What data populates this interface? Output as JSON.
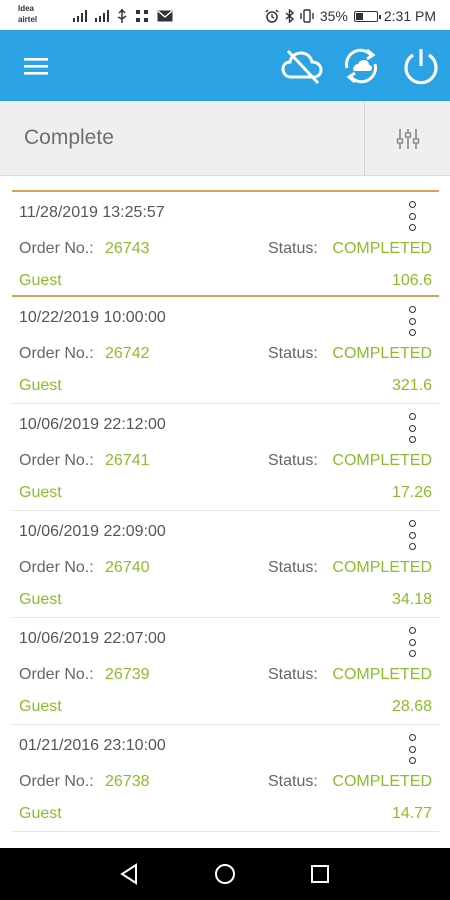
{
  "status_bar": {
    "carrier_1": "Idea",
    "carrier_2": "airtel",
    "battery_percent": "35%",
    "battery_level": 0.35,
    "time": "2:31 PM",
    "icons": [
      "signal-icon",
      "signal-icon",
      "usb-icon",
      "notification-dots-icon",
      "mail-icon",
      "alarm-icon",
      "bluetooth-icon",
      "vibrate-icon",
      "battery-icon"
    ]
  },
  "app_bar": {
    "color": "#2aa2e3",
    "icons": [
      "menu-icon",
      "cloud-off-icon",
      "sync-icon",
      "power-icon"
    ]
  },
  "filter": {
    "title": "Complete",
    "icon": "filter-sliders-icon"
  },
  "orders": [
    {
      "date": "11/28/2019 13:25:57",
      "order_label": "Order No.:",
      "order_no": "26743",
      "status_label": "Status:",
      "status": "COMPLETED",
      "customer": "Guest",
      "amount": "106.6",
      "selected": true
    },
    {
      "date": "10/22/2019 10:00:00",
      "order_label": "Order No.:",
      "order_no": "26742",
      "status_label": "Status:",
      "status": "COMPLETED",
      "customer": "Guest",
      "amount": "321.6"
    },
    {
      "date": "10/06/2019 22:12:00",
      "order_label": "Order No.:",
      "order_no": "26741",
      "status_label": "Status:",
      "status": "COMPLETED",
      "customer": "Guest",
      "amount": "17.26"
    },
    {
      "date": "10/06/2019 22:09:00",
      "order_label": "Order No.:",
      "order_no": "26740",
      "status_label": "Status:",
      "status": "COMPLETED",
      "customer": "Guest",
      "amount": "34.18"
    },
    {
      "date": "10/06/2019 22:07:00",
      "order_label": "Order No.:",
      "order_no": "26739",
      "status_label": "Status:",
      "status": "COMPLETED",
      "customer": "Guest",
      "amount": "28.68"
    },
    {
      "date": "01/21/2016 23:10:00",
      "order_label": "Order No.:",
      "order_no": "26738",
      "status_label": "Status:",
      "status": "COMPLETED",
      "customer": "Guest",
      "amount": "14.77"
    }
  ],
  "colors": {
    "accent_green": "#8bbd2a",
    "selected_border": "#d8a24f"
  },
  "nav_bar": {
    "icons": [
      "back-icon",
      "home-icon",
      "recents-icon"
    ]
  }
}
